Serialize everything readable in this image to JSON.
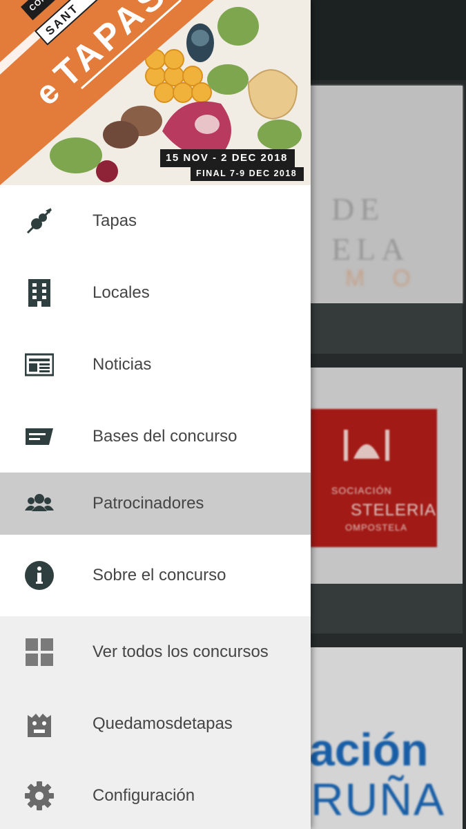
{
  "banner": {
    "title_prefix": "e",
    "title_main": "TAPAS",
    "tag_top": "CONC",
    "tag_city": "SANT",
    "dates": "15 NOV - 2 DEC 2018",
    "final": "FINAL 7-9 DEC 2018"
  },
  "menu": {
    "items": [
      {
        "label": "Tapas",
        "icon": "skewer-icon"
      },
      {
        "label": "Locales",
        "icon": "building-icon"
      },
      {
        "label": "Noticias",
        "icon": "newspaper-icon"
      },
      {
        "label": "Bases del concurso",
        "icon": "message-icon"
      },
      {
        "label": "Patrocinadores",
        "icon": "people-icon",
        "selected": true
      },
      {
        "label": "Sobre el concurso",
        "icon": "info-icon"
      }
    ],
    "secondary": [
      {
        "label": "Ver todos los concursos",
        "icon": "grid-icon"
      },
      {
        "label": "Quedamosdetapas",
        "icon": "monster-icon"
      },
      {
        "label": "Configuración",
        "icon": "gear-icon"
      }
    ]
  },
  "background": {
    "card1_logo": "DE\nELA",
    "card1_sub": "MO",
    "card2_lines": [
      "SOCIACIÓN",
      "STELERIA",
      "OMPOSTELA"
    ],
    "card3_line1": "ación",
    "card3_line2": "RUÑA"
  },
  "colors": {
    "brand_orange": "#e37b3b",
    "icon_dark": "#2f3e3e",
    "selected_bg": "#cbcbcb",
    "secondary_bg": "#efefef"
  }
}
